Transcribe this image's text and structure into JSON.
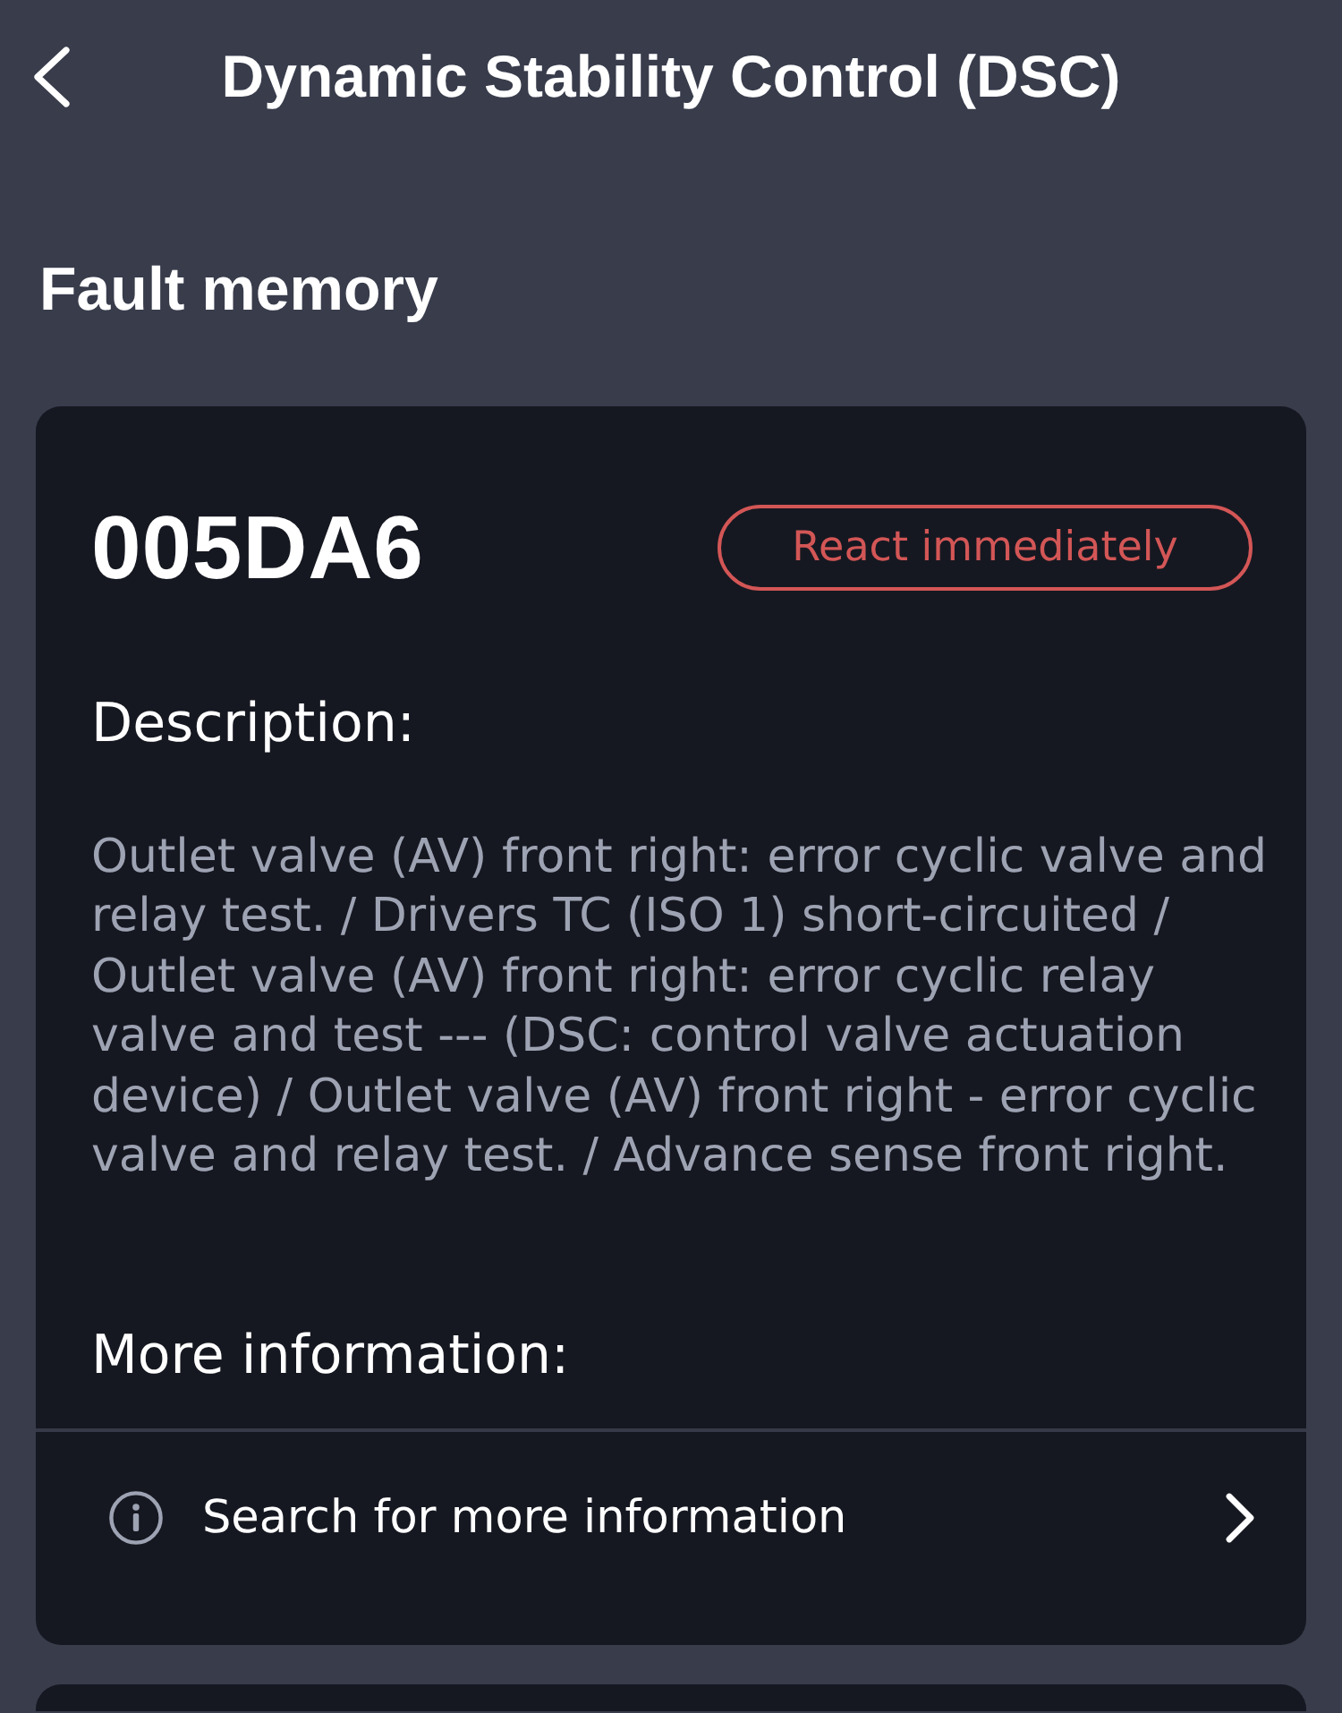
{
  "header": {
    "title": "Dynamic Stability Control (DSC)"
  },
  "section_title": "Fault memory",
  "faults": [
    {
      "code": "005DA6",
      "severity": {
        "label": "React immediately",
        "color": "#d35656"
      },
      "description_label": "Description:",
      "description": "Outlet valve (AV) front right: error cyclic valve and relay test. / Drivers TC (ISO 1) short-circuited / Outlet valve (AV) front right: error cyclic relay valve and test --- (DSC: control valve actuation device) / Outlet valve (AV) front right - error cyclic valve and relay test. / Advance sense front right.",
      "more_info_label": "More information:",
      "links": [
        {
          "label": "Search for more information"
        }
      ]
    }
  ]
}
